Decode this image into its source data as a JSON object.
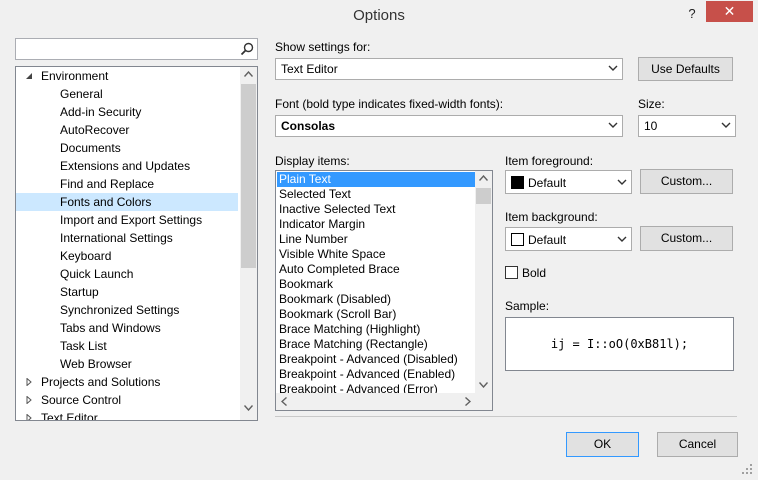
{
  "window": {
    "title": "Options",
    "help_glyph": "?",
    "close_glyph": "✕"
  },
  "search": {
    "value": "",
    "placeholder": ""
  },
  "tree": {
    "items": [
      {
        "label": "Environment",
        "level": 0,
        "expander": "expanded"
      },
      {
        "label": "General",
        "level": 1
      },
      {
        "label": "Add-in Security",
        "level": 1
      },
      {
        "label": "AutoRecover",
        "level": 1
      },
      {
        "label": "Documents",
        "level": 1
      },
      {
        "label": "Extensions and Updates",
        "level": 1
      },
      {
        "label": "Find and Replace",
        "level": 1
      },
      {
        "label": "Fonts and Colors",
        "level": 1,
        "selected": true
      },
      {
        "label": "Import and Export Settings",
        "level": 1
      },
      {
        "label": "International Settings",
        "level": 1
      },
      {
        "label": "Keyboard",
        "level": 1
      },
      {
        "label": "Quick Launch",
        "level": 1
      },
      {
        "label": "Startup",
        "level": 1
      },
      {
        "label": "Synchronized Settings",
        "level": 1
      },
      {
        "label": "Tabs and Windows",
        "level": 1
      },
      {
        "label": "Task List",
        "level": 1
      },
      {
        "label": "Web Browser",
        "level": 1
      },
      {
        "label": "Projects and Solutions",
        "level": 0,
        "expander": "collapsed"
      },
      {
        "label": "Source Control",
        "level": 0,
        "expander": "collapsed"
      },
      {
        "label": "Text Editor",
        "level": 0,
        "expander": "collapsed"
      }
    ]
  },
  "settings": {
    "show_for_label": "Show settings for:",
    "show_for_value": "Text Editor",
    "use_defaults_label": "Use Defaults",
    "font_label": "Font (bold type indicates fixed-width fonts):",
    "font_value": "Consolas",
    "size_label": "Size:",
    "size_value": "10"
  },
  "display_items": {
    "label": "Display items:",
    "items": [
      "Plain Text",
      "Selected Text",
      "Inactive Selected Text",
      "Indicator Margin",
      "Line Number",
      "Visible White Space",
      "Auto Completed Brace",
      "Bookmark",
      "Bookmark (Disabled)",
      "Bookmark (Scroll Bar)",
      "Brace Matching (Highlight)",
      "Brace Matching (Rectangle)",
      "Breakpoint - Advanced (Disabled)",
      "Breakpoint - Advanced (Enabled)",
      "Breakpoint - Advanced (Error)"
    ],
    "selected_index": 0
  },
  "foreground": {
    "label": "Item foreground:",
    "value": "Default",
    "swatch": "#000000",
    "custom_label": "Custom..."
  },
  "background": {
    "label": "Item background:",
    "value": "Default",
    "swatch": "#ffffff",
    "custom_label": "Custom..."
  },
  "bold": {
    "label": "Bold",
    "checked": false
  },
  "sample": {
    "label": "Sample:",
    "text": "ij = I::oO(0xB81l);"
  },
  "footer": {
    "ok_label": "OK",
    "cancel_label": "Cancel"
  },
  "colors": {
    "selection": "#3399ff",
    "tree_selection": "#cce8ff",
    "close": "#c7504a",
    "accent": "#3399ff"
  }
}
